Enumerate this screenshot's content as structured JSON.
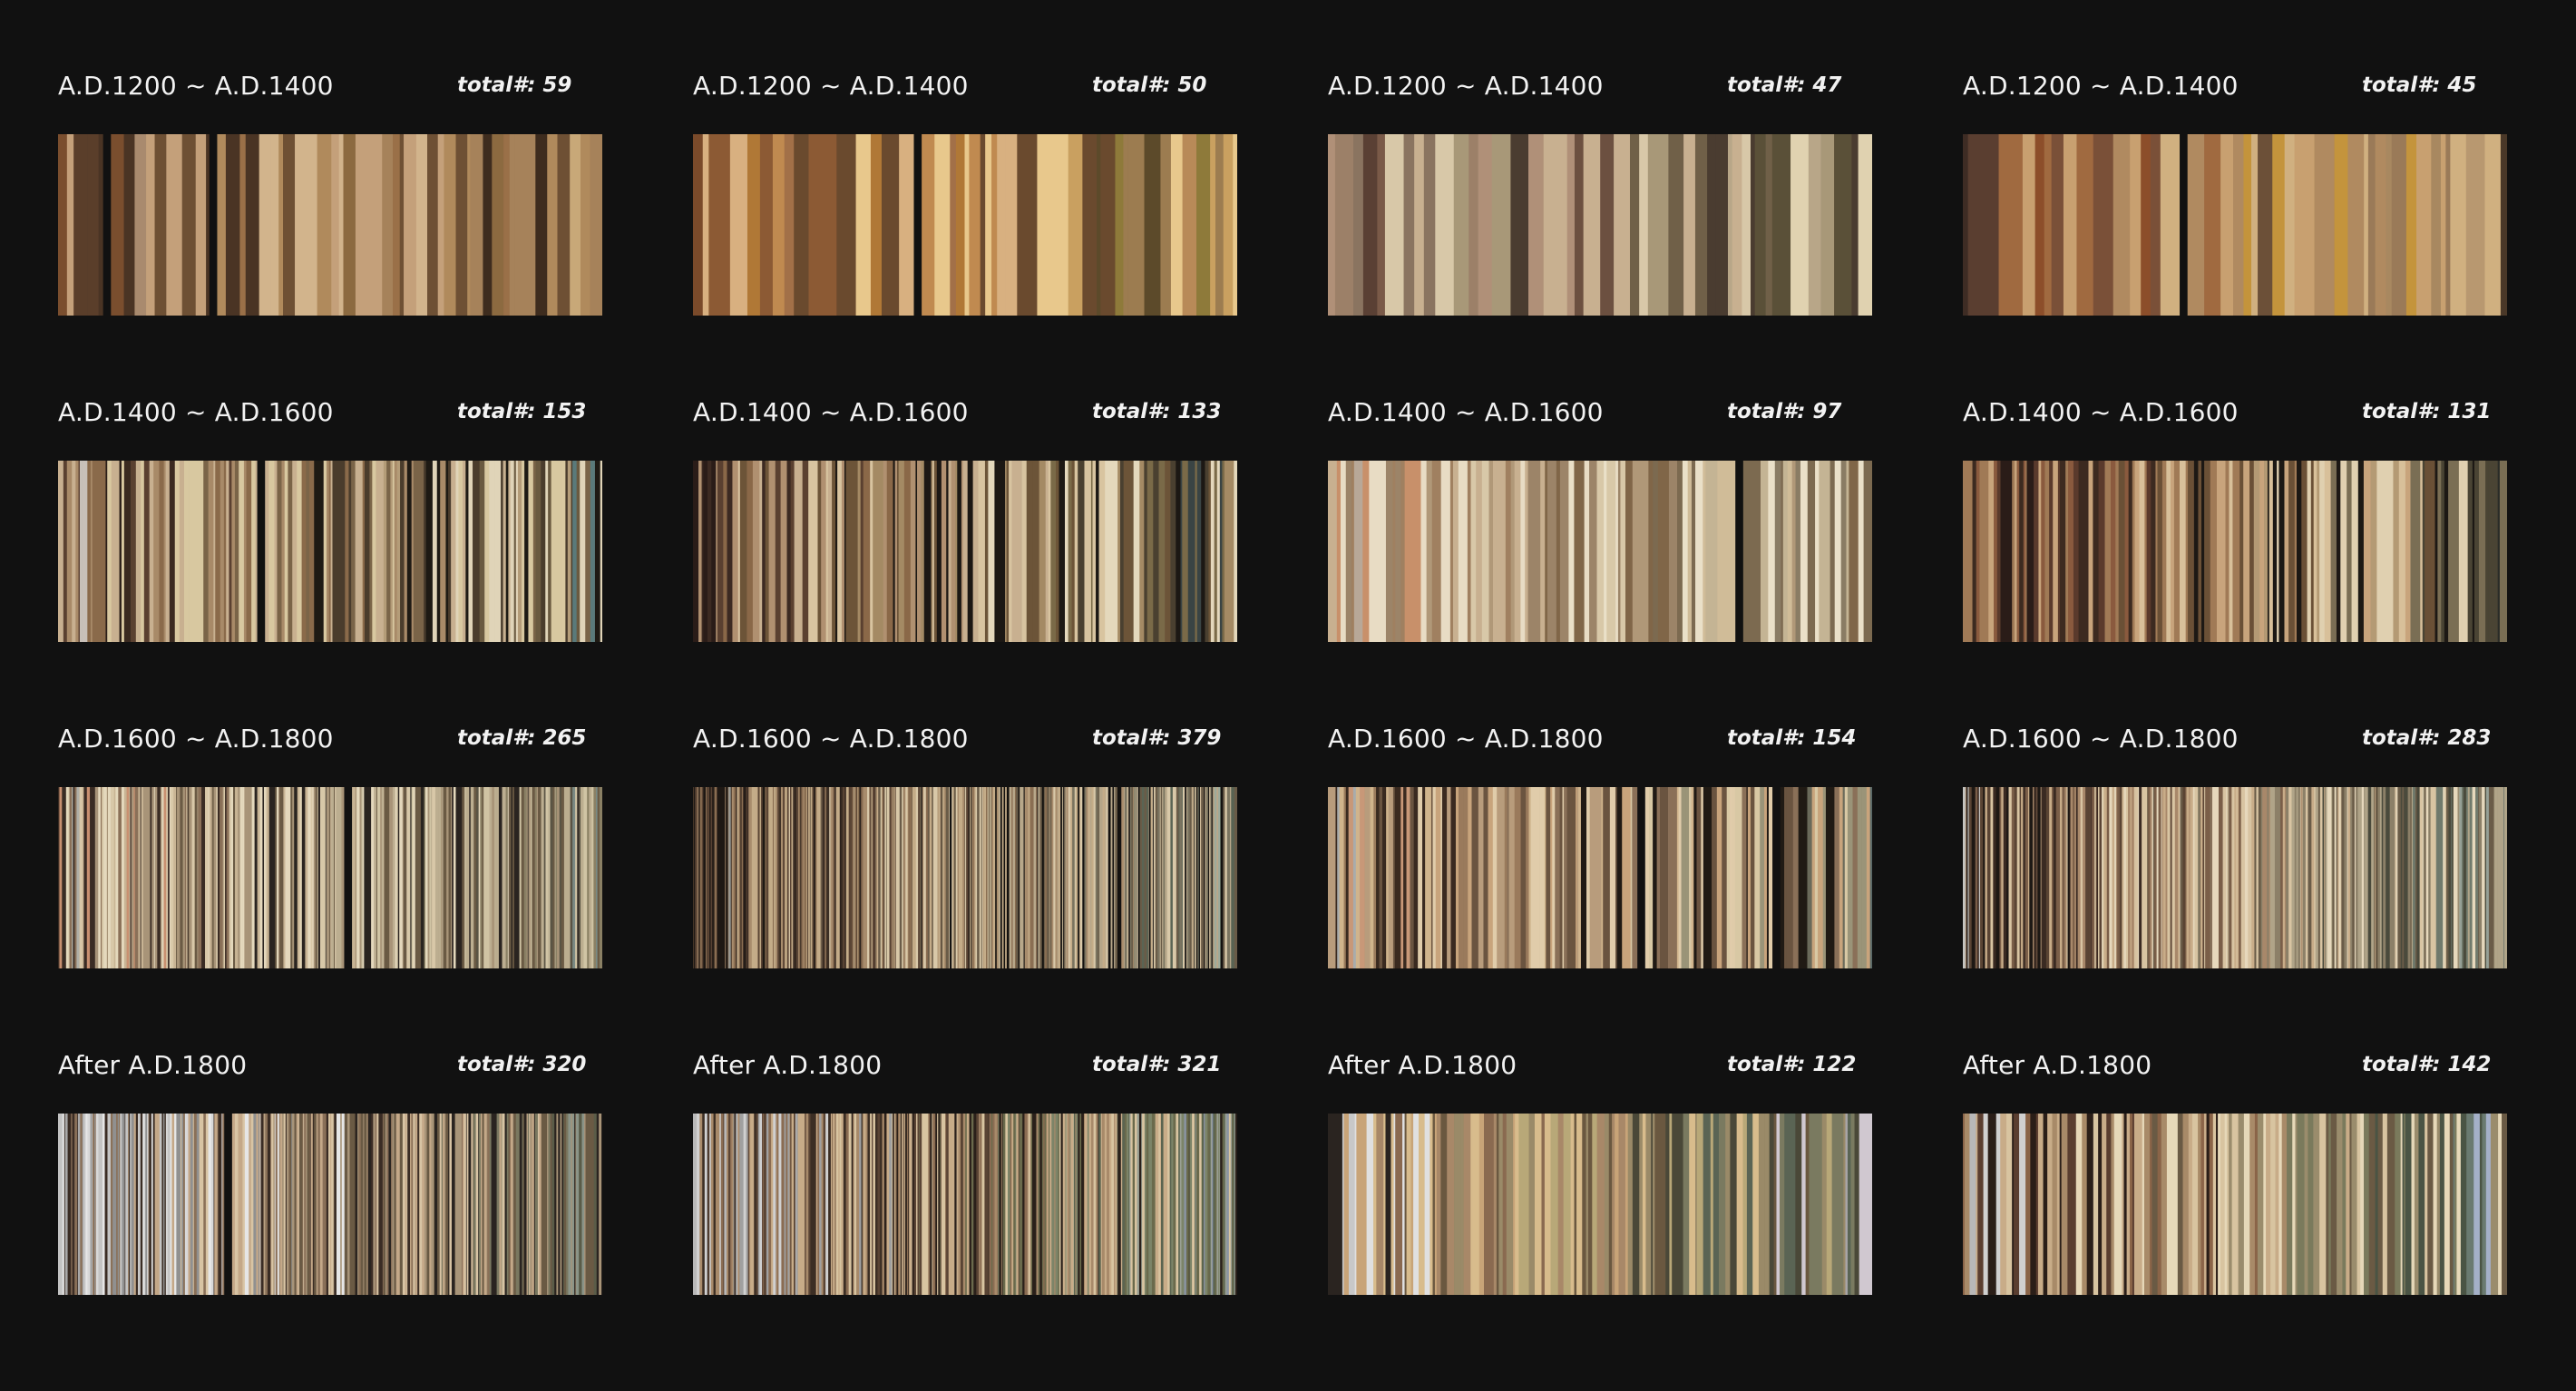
{
  "cells": [
    {
      "period": "A.D.1200 ~ A.D.1400",
      "total": "total#: 59",
      "count": 59,
      "palette": [
        "#8a6a5a",
        "#5a3e2a",
        "#7a4e2e",
        "#a98a6e",
        "#4a3424",
        "#c4a07a",
        "#9a7048",
        "#6e5034",
        "#b08a5c",
        "#d2b48c",
        "#8c6a40",
        "#a6825a",
        "#3e2c1e",
        "#c8a878",
        "#7c6a50"
      ],
      "gaps": [
        0.09,
        0.3
      ]
    },
    {
      "period": "A.D.1200 ~ A.D.1400",
      "total": "total#: 50",
      "count": 50,
      "palette": [
        "#7a4a2a",
        "#4a2e1e",
        "#8c5a34",
        "#a27048",
        "#c08a50",
        "#d8b080",
        "#b07836",
        "#6a4a2e",
        "#e8c88c",
        "#9c7c50",
        "#5c4a2a",
        "#8e7a3a",
        "#c9a060",
        "#b88a58",
        "#3a2818"
      ],
      "gaps": [
        0.36
      ]
    },
    {
      "period": "A.D.1200 ~ A.D.1400",
      "total": "total#: 47",
      "count": 47,
      "palette": [
        "#5a4034",
        "#7a5a48",
        "#9c8068",
        "#b09078",
        "#6c5040",
        "#8a7460",
        "#c8b090",
        "#d8c8a8",
        "#a89878",
        "#4a3c30",
        "#706048",
        "#5a5038",
        "#b8a688",
        "#e0d2b0",
        "#8c7856"
      ],
      "gaps": []
    },
    {
      "period": "A.D.1200 ~ A.D.1400",
      "total": "total#: 45",
      "count": 45,
      "palette": [
        "#5a3e30",
        "#3e2c24",
        "#7a5038",
        "#8c4e2a",
        "#a06a40",
        "#6c5038",
        "#b08a60",
        "#c8a070",
        "#d0b080",
        "#9a7a58",
        "#c4943c",
        "#7c6a3a",
        "#a88860",
        "#4a3828",
        "#b89870"
      ],
      "gaps": [
        0.4
      ]
    },
    {
      "period": "A.D.1400 ~ A.D.1600",
      "total": "total#: 153",
      "count": 153,
      "palette": [
        "#c8c0b8",
        "#2a1e18",
        "#3a2a20",
        "#5a4030",
        "#8a6a4a",
        "#a88a68",
        "#c8b090",
        "#d8c8a0",
        "#7a6448",
        "#1e1a14",
        "#4a3c2c",
        "#b49c78",
        "#e0d4b8",
        "#6a5a40",
        "#5a7a7a"
      ],
      "gaps": [
        0.35
      ]
    },
    {
      "period": "A.D.1400 ~ A.D.1600",
      "total": "total#: 133",
      "count": 133,
      "palette": [
        "#2a1c18",
        "#3c2a22",
        "#5a4030",
        "#8a6848",
        "#b09070",
        "#c8b090",
        "#d8c4a0",
        "#6c5438",
        "#1c1814",
        "#a48a64",
        "#e4d8bc",
        "#7a6a48",
        "#4a4030",
        "#3a4444",
        "#2a2e2a"
      ],
      "gaps": []
    },
    {
      "period": "A.D.1400 ~ A.D.1600",
      "total": "total#: 97",
      "count": 97,
      "palette": [
        "#b8a898",
        "#c8906a",
        "#a08060",
        "#c8b090",
        "#d8c8a8",
        "#e8dcc4",
        "#9c8468",
        "#b09878",
        "#806648",
        "#d0bc98",
        "#eae0c8",
        "#7c6a50",
        "#c4b494",
        "#8a7c64",
        "#5c5040"
      ],
      "gaps": [
        0.78
      ]
    },
    {
      "period": "A.D.1400 ~ A.D.1600",
      "total": "total#: 131",
      "count": 131,
      "palette": [
        "#d0ccc4",
        "#2a1c18",
        "#5a3a2c",
        "#8a5a3e",
        "#3c2a20",
        "#a07a56",
        "#c8a47c",
        "#d8c09a",
        "#6a5036",
        "#1c1814",
        "#b49a74",
        "#e0d0b0",
        "#7a6e54",
        "#4a4434",
        "#2a2c28"
      ],
      "gaps": []
    },
    {
      "period": "A.D.1600 ~ A.D.1800",
      "total": "total#: 265",
      "count": 265,
      "palette": [
        "#b0b0a8",
        "#c89070",
        "#3a2c24",
        "#8a7058",
        "#c8b494",
        "#d8c8a8",
        "#e4d8bc",
        "#a89478",
        "#6a5a44",
        "#2a2420",
        "#bcae90",
        "#d0c4a4",
        "#8a8064",
        "#5a5444",
        "#7a8a84"
      ],
      "gaps": [
        0.54
      ]
    },
    {
      "period": "A.D.1600 ~ A.D.1800",
      "total": "total#: 379",
      "count": 379,
      "palette": [
        "#9a9a94",
        "#1e1814",
        "#2a201a",
        "#3c2e24",
        "#5a4434",
        "#8a6e52",
        "#a88c6c",
        "#c4ac88",
        "#d8c8a8",
        "#6a5c48",
        "#141210",
        "#b8a88a",
        "#7a7460",
        "#5a6454",
        "#9cac9c"
      ],
      "gaps": []
    },
    {
      "period": "A.D.1600 ~ A.D.1800",
      "total": "total#: 154",
      "count": 154,
      "palette": [
        "#a8acac",
        "#c89878",
        "#3a2a20",
        "#9a7a5c",
        "#b89c7c",
        "#d0b48c",
        "#e0ccaa",
        "#6a5440",
        "#c8a47c",
        "#8a7058",
        "#201a14",
        "#d8c8a4",
        "#9a9478",
        "#6a6a5a",
        "#5c6a68"
      ],
      "gaps": [
        0.59,
        0.83
      ]
    },
    {
      "period": "A.D.1600 ~ A.D.1800",
      "total": "total#: 283",
      "count": 283,
      "palette": [
        "#c4c4c0",
        "#1e1814",
        "#3a2a22",
        "#5a4434",
        "#7a5e48",
        "#a8886a",
        "#c8ac88",
        "#d8c4a2",
        "#e6d8bc",
        "#6a5c48",
        "#8c8068",
        "#b0a488",
        "#4a4a3c",
        "#707a6c",
        "#96a096"
      ],
      "gaps": []
    },
    {
      "period": "After A.D.1800",
      "total": "total#: 320",
      "count": 320,
      "palette": [
        "#a8a8a8",
        "#c4c4c4",
        "#d8d8d8",
        "#909090",
        "#e6e6e6",
        "#3a2c24",
        "#8a7058",
        "#c4a888",
        "#d8c4a4",
        "#a89478",
        "#6a5a44",
        "#2a2420",
        "#7a7860",
        "#5a5c48",
        "#8a9488"
      ],
      "gaps": [
        0.31
      ]
    },
    {
      "period": "After A.D.1800",
      "total": "total#: 321",
      "count": 321,
      "palette": [
        "#b8b8b8",
        "#d0d0d0",
        "#a0a0a0",
        "#3c2e24",
        "#5a4434",
        "#8a6c52",
        "#a88a6a",
        "#c8ac88",
        "#d8c4a0",
        "#2a201a",
        "#6a6a4c",
        "#7c8468",
        "#5a6450",
        "#9aa094",
        "#8a94a4"
      ],
      "gaps": []
    },
    {
      "period": "After A.D.1800",
      "total": "total#: 122",
      "count": 122,
      "palette": [
        "#c8c8c8",
        "#e0e0e0",
        "#2a2420",
        "#8a6a50",
        "#a88868",
        "#c8a478",
        "#d8bc8c",
        "#6a5840",
        "#9a8a68",
        "#b8a878",
        "#4a4838",
        "#7a7a60",
        "#5a6454",
        "#d0c8d0",
        "#a8a4a8"
      ],
      "gaps": []
    },
    {
      "period": "After A.D.1800",
      "total": "total#: 142",
      "count": 142,
      "palette": [
        "#b8b8b8",
        "#d0d0d0",
        "#5a3e30",
        "#2a1e18",
        "#8a6448",
        "#a88a68",
        "#c8ac88",
        "#d8c4a0",
        "#e6d8b8",
        "#6a5a44",
        "#9a8c6c",
        "#7a7a5c",
        "#4a5444",
        "#6a7a70",
        "#a4b0c8"
      ],
      "gaps": []
    }
  ]
}
